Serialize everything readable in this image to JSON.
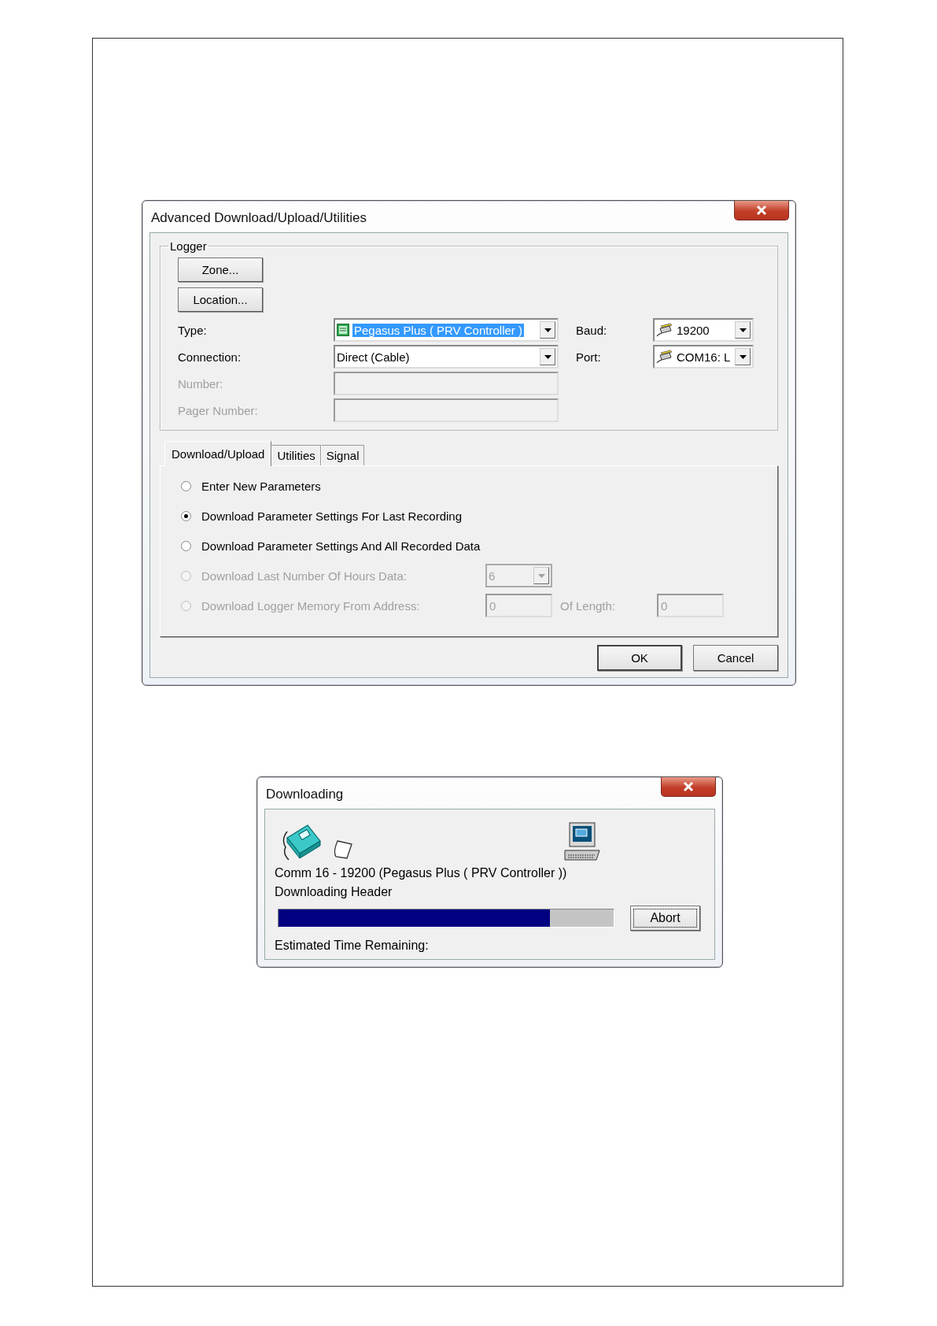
{
  "advanced_dialog": {
    "title": "Advanced Download/Upload/Utilities",
    "logger": {
      "label": "Logger",
      "buttons": [
        "Zone...",
        "Location..."
      ],
      "fields": [
        {
          "label": "Type:",
          "kind": "icon_combo",
          "value": "Pegasus Plus ( PRV Controller )",
          "highlighted": true,
          "disabled": false
        },
        {
          "label": "Connection:",
          "kind": "combo",
          "value": "Direct (Cable)",
          "highlighted": false,
          "disabled": false
        },
        {
          "label": "Number:",
          "kind": "text",
          "disabled": true
        },
        {
          "label": "Pager Number:",
          "kind": "text",
          "disabled": true
        }
      ],
      "port_fields": [
        {
          "label": "Baud:",
          "kind": "port_combo",
          "value": "19200"
        },
        {
          "label": "Port:",
          "kind": "port_combo",
          "value": "COM16: L"
        }
      ]
    },
    "tabs": [
      {
        "label": "Download/Upload",
        "selected": true
      },
      {
        "label": "Utilities",
        "selected": false
      },
      {
        "label": "Signal",
        "selected": false
      }
    ],
    "options": [
      {
        "label": "Enter New Parameters",
        "selected": false,
        "disabled": false
      },
      {
        "label": "Download Parameter Settings For Last Recording",
        "selected": true,
        "disabled": false
      },
      {
        "label": "Download Parameter Settings And All Recorded Data",
        "selected": false,
        "disabled": false
      },
      {
        "label": "Download Last Number Of Hours Data:",
        "selected": false,
        "disabled": true,
        "controls": [
          {
            "kind": "combo",
            "value": "6"
          }
        ]
      },
      {
        "label": "Download Logger Memory From Address:",
        "selected": false,
        "disabled": true,
        "controls": [
          {
            "kind": "text",
            "value": "0"
          },
          {
            "kind": "label",
            "text": "Of Length:"
          },
          {
            "kind": "text",
            "value": "0"
          }
        ]
      }
    ],
    "buttons": [
      {
        "label": "OK",
        "default": true
      },
      {
        "label": "Cancel",
        "default": false
      }
    ]
  },
  "downloading_dialog": {
    "title": "Downloading",
    "status_lines": [
      "Comm 16 - 19200 (Pegasus Plus ( PRV Controller ))",
      "Downloading Header"
    ],
    "progress": {
      "level": 0.81
    },
    "abort_button": "Abort",
    "time_label": "Estimated Time Remaining:"
  }
}
